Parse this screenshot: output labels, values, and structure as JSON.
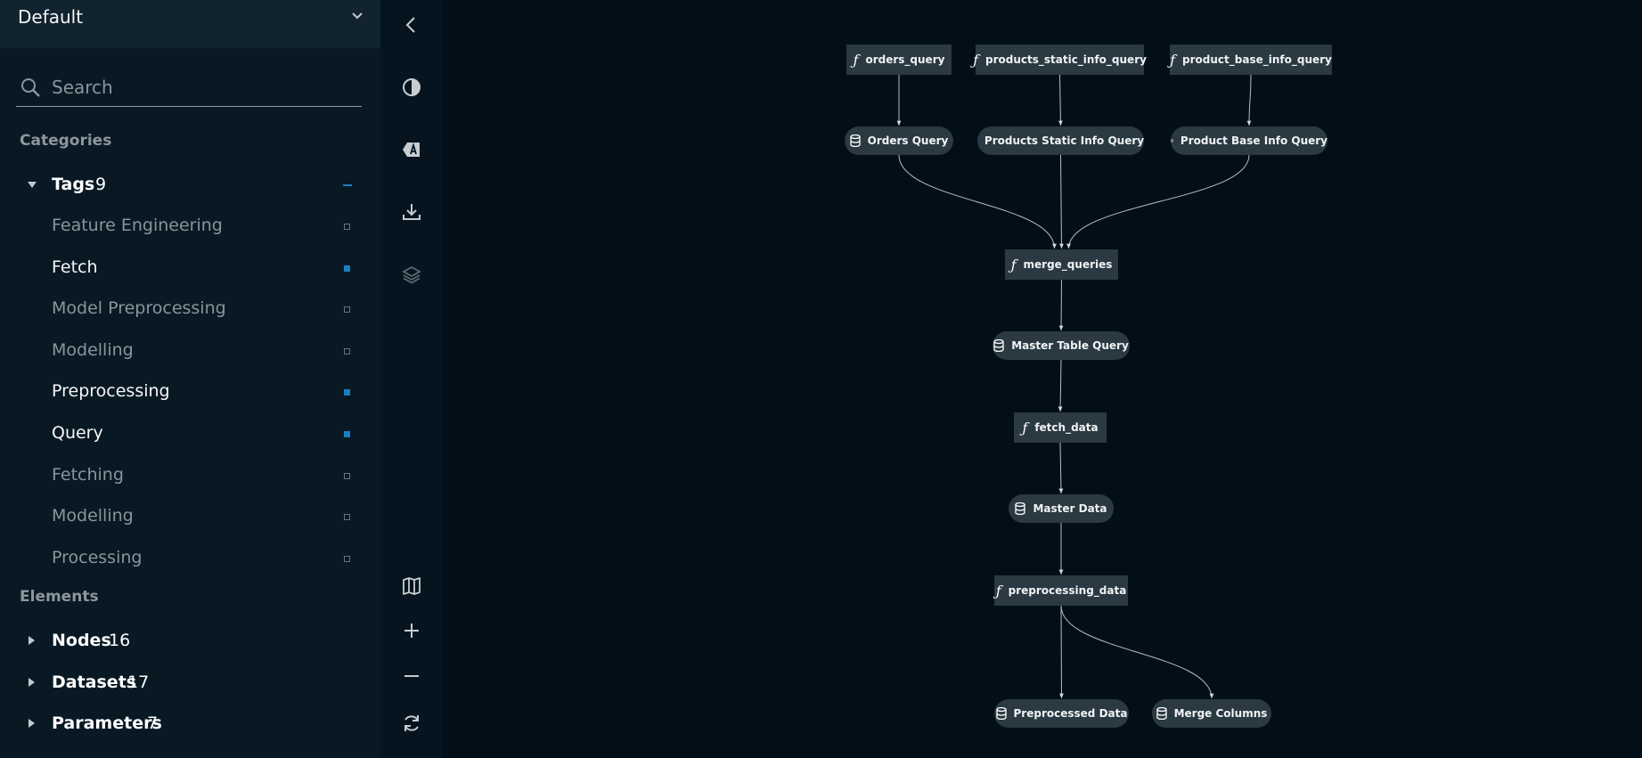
{
  "sidebar": {
    "pipeline": "Default",
    "search_placeholder": "Search",
    "categories_title": "Categories",
    "tags": {
      "label": "Tags",
      "count": "9",
      "items": [
        {
          "label": "Feature Engineering",
          "active": false
        },
        {
          "label": "Fetch",
          "active": true
        },
        {
          "label": "Model Preprocessing",
          "active": false
        },
        {
          "label": "Modelling",
          "active": false
        },
        {
          "label": "Preprocessing",
          "active": true
        },
        {
          "label": "Query",
          "active": true
        },
        {
          "label": "Fetching",
          "active": false
        },
        {
          "label": "Modelling",
          "active": false
        },
        {
          "label": "Processing",
          "active": false
        }
      ]
    },
    "elements_title": "Elements",
    "elements": [
      {
        "label": "Nodes",
        "count": "16"
      },
      {
        "label": "Datasets",
        "count": "17"
      },
      {
        "label": "Parameters",
        "count": "7"
      }
    ]
  },
  "toolbar": {
    "icons": [
      "back-icon",
      "theme-icon",
      "label-icon",
      "download-icon",
      "layers-icon",
      "map-icon",
      "zoom-in-icon",
      "zoom-out-icon",
      "reset-icon"
    ]
  },
  "graph": {
    "nodes": [
      {
        "id": "orders_query",
        "label": "orders_query",
        "kind": "task"
      },
      {
        "id": "products_static_info_query",
        "label": "products_static_info_query",
        "kind": "task"
      },
      {
        "id": "product_base_info_query",
        "label": "product_base_info_query",
        "kind": "task"
      },
      {
        "id": "orders_ds",
        "label": "Orders Query",
        "kind": "data"
      },
      {
        "id": "products_ds",
        "label": "Products Static Info Query",
        "kind": "data"
      },
      {
        "id": "base_ds",
        "label": "Product Base Info Query",
        "kind": "data"
      },
      {
        "id": "merge_queries",
        "label": "merge_queries",
        "kind": "task"
      },
      {
        "id": "master_table_ds",
        "label": "Master Table Query",
        "kind": "data"
      },
      {
        "id": "fetch_data",
        "label": "fetch_data",
        "kind": "task"
      },
      {
        "id": "master_data_ds",
        "label": "Master Data",
        "kind": "data"
      },
      {
        "id": "preprocessing_data",
        "label": "preprocessing_data",
        "kind": "task"
      },
      {
        "id": "preprocessed_ds",
        "label": "Preprocessed Data",
        "kind": "data"
      },
      {
        "id": "merge_columns_ds",
        "label": "Merge Columns",
        "kind": "data"
      }
    ],
    "edges": [
      [
        "orders_query",
        "orders_ds"
      ],
      [
        "products_static_info_query",
        "products_ds"
      ],
      [
        "product_base_info_query",
        "base_ds"
      ],
      [
        "orders_ds",
        "merge_queries"
      ],
      [
        "products_ds",
        "merge_queries"
      ],
      [
        "base_ds",
        "merge_queries"
      ],
      [
        "merge_queries",
        "master_table_ds"
      ],
      [
        "master_table_ds",
        "fetch_data"
      ],
      [
        "fetch_data",
        "master_data_ds"
      ],
      [
        "master_data_ds",
        "preprocessing_data"
      ],
      [
        "preprocessing_data",
        "preprocessed_ds"
      ],
      [
        "preprocessing_data",
        "merge_columns_ds"
      ]
    ]
  }
}
